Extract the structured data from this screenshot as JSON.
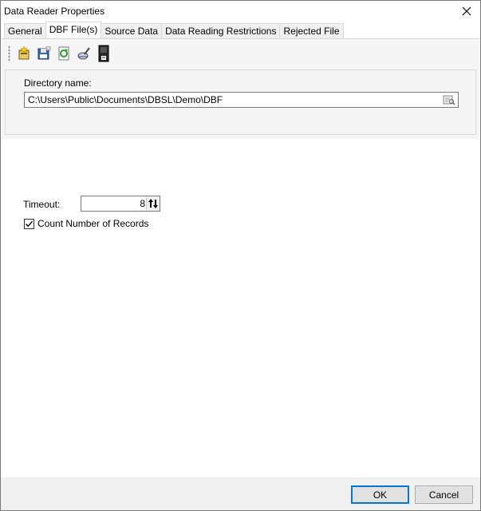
{
  "window": {
    "title": "Data Reader Properties",
    "close_icon": "close-icon"
  },
  "tabs": [
    {
      "label": "General",
      "active": false
    },
    {
      "label": "DBF File(s)",
      "active": true
    },
    {
      "label": "Source Data",
      "active": false
    },
    {
      "label": "Data Reading Restrictions",
      "active": false
    },
    {
      "label": "Rejected File",
      "active": false
    }
  ],
  "toolbar": {
    "icons": [
      "new-icon",
      "save-icon",
      "refresh-icon",
      "clean-icon",
      "document-icon"
    ]
  },
  "directory": {
    "label": "Directory name:",
    "value": "C:\\Users\\Public\\Documents\\DBSL\\Demo\\DBF",
    "browse_icon": "browse-folder-icon"
  },
  "timeout": {
    "label": "Timeout:",
    "value": "8"
  },
  "count_records": {
    "label": "Count Number of Records",
    "checked": true
  },
  "buttons": {
    "ok": "OK",
    "cancel": "Cancel"
  },
  "colors": {
    "ok_border": "#0078d7",
    "panel_bg": "#f5f5f5"
  }
}
